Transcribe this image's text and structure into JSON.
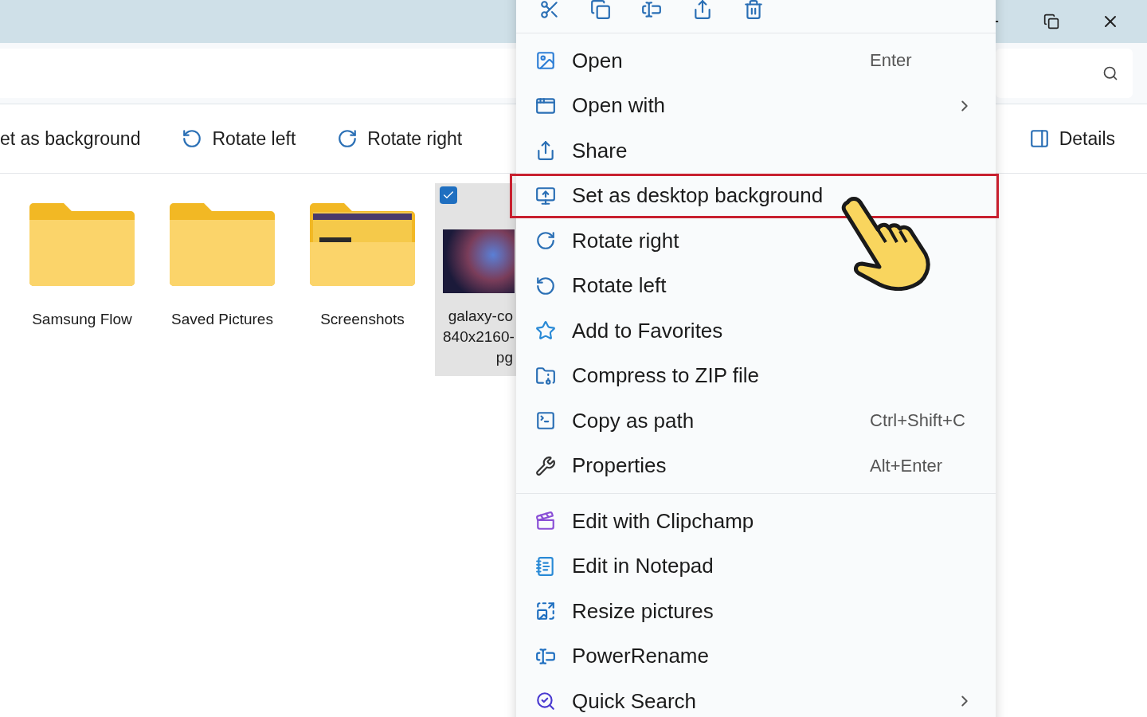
{
  "toolbar": {
    "items": [
      {
        "label": "et as background"
      },
      {
        "label": "Rotate left"
      },
      {
        "label": "Rotate right"
      }
    ],
    "details": {
      "label": "Details"
    }
  },
  "files": [
    {
      "name_lines": [
        "Samsung Flow"
      ],
      "kind": "folder",
      "selected": false
    },
    {
      "name_lines": [
        "Saved Pictures"
      ],
      "kind": "folder",
      "selected": false
    },
    {
      "name_lines": [
        "Screenshots"
      ],
      "kind": "folder_preview",
      "selected": false
    },
    {
      "name_lines": [
        "galaxy-co",
        "840x2160-",
        "pg"
      ],
      "kind": "image",
      "selected": true
    }
  ],
  "context_menu": {
    "sections": [
      [
        {
          "label": "Open",
          "shortcut": "Enter",
          "submenu": false,
          "highlighted": false
        },
        {
          "label": "Open with",
          "submenu": true,
          "highlighted": false
        },
        {
          "label": "Share",
          "submenu": false,
          "highlighted": false
        },
        {
          "label": "Set as desktop background",
          "submenu": false,
          "highlighted": true
        },
        {
          "label": "Rotate right",
          "submenu": false,
          "highlighted": false
        },
        {
          "label": "Rotate left",
          "submenu": false,
          "highlighted": false
        },
        {
          "label": "Add to Favorites",
          "submenu": false,
          "highlighted": false
        },
        {
          "label": "Compress to ZIP file",
          "submenu": false,
          "highlighted": false
        },
        {
          "label": "Copy as path",
          "shortcut": "Ctrl+Shift+C",
          "submenu": false,
          "highlighted": false
        },
        {
          "label": "Properties",
          "shortcut": "Alt+Enter",
          "submenu": false,
          "highlighted": false
        }
      ],
      [
        {
          "label": "Edit with Clipchamp",
          "submenu": false,
          "highlighted": false
        },
        {
          "label": "Edit in Notepad",
          "submenu": false,
          "highlighted": false
        },
        {
          "label": "Resize pictures",
          "submenu": false,
          "highlighted": false
        },
        {
          "label": "PowerRename",
          "submenu": false,
          "highlighted": false
        },
        {
          "label": "Quick Search",
          "submenu": true,
          "highlighted": false
        }
      ]
    ]
  }
}
